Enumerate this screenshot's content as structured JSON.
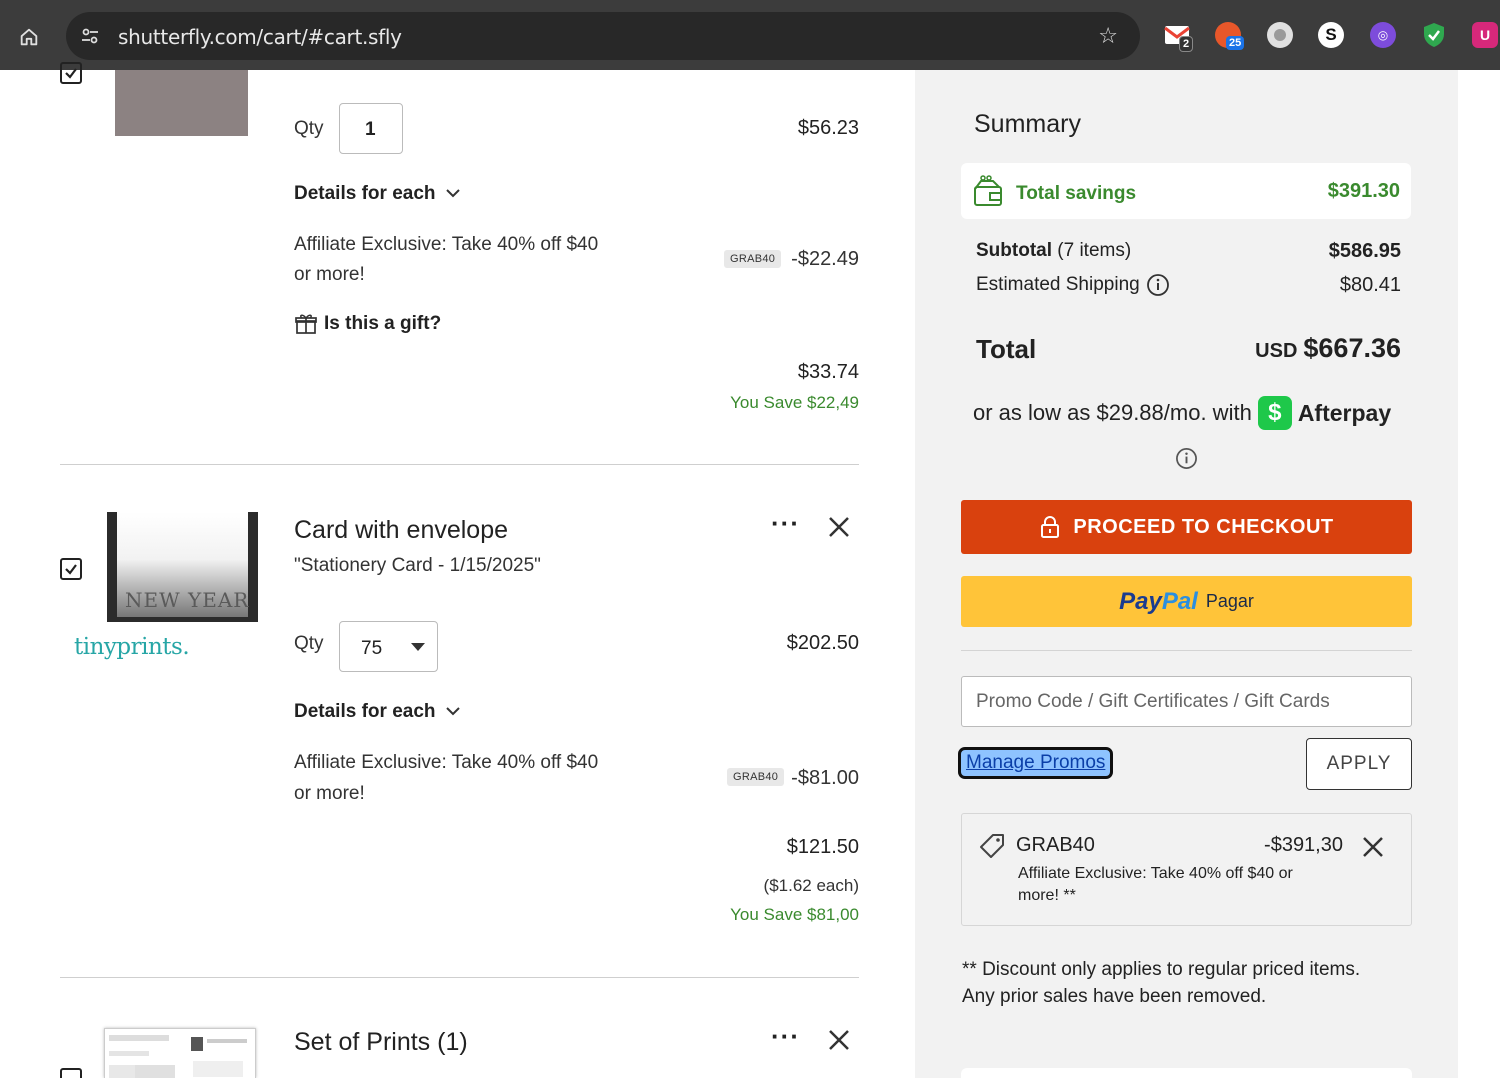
{
  "browser": {
    "url": "shutterfly.com/cart/#cart.sfly",
    "extensions": [
      {
        "name": "gmail-icon",
        "badge": "2"
      },
      {
        "name": "ext-25-icon",
        "badge": "25"
      },
      {
        "name": "circle-ext-icon"
      },
      {
        "name": "s-ext-icon",
        "label": "S"
      },
      {
        "name": "purple-ext-icon"
      },
      {
        "name": "shield-ext-icon"
      },
      {
        "name": "u-ext-icon",
        "label": "U"
      }
    ]
  },
  "item1": {
    "qty_label": "Qty",
    "qty": "1",
    "price": "$56.23",
    "details_label": "Details for each",
    "promo_text_line1": "Affiliate Exclusive: Take 40% off $40",
    "promo_text_line2": "or more!",
    "promo_code": "GRAB40",
    "promo_amount": "-$22.49",
    "gift_label": "Is this a gift?",
    "final_price": "$33.74",
    "you_save": "You Save $22,49"
  },
  "item2": {
    "title": "Card with envelope",
    "subtitle": "\"Stationery Card - 1/15/2025\"",
    "brand": "tinyprints.",
    "thumb_text": "NEW YEAR",
    "qty_label": "Qty",
    "qty": "75",
    "price": "$202.50",
    "details_label": "Details for each",
    "promo_text_line1": "Affiliate Exclusive: Take 40% off $40",
    "promo_text_line2": "or more!",
    "promo_code": "GRAB40",
    "promo_amount": "-$81.00",
    "final_price": "$121.50",
    "each_price": "($1.62 each)",
    "you_save": "You Save $81,00"
  },
  "item3": {
    "title": "Set of Prints (1)"
  },
  "summary": {
    "heading": "Summary",
    "savings_label": "Total savings",
    "savings_value": "$391.30",
    "subtotal_label": "Subtotal",
    "subtotal_items": "(7 items)",
    "subtotal_value": "$586.95",
    "shipping_label": "Estimated Shipping",
    "shipping_value": "$80.41",
    "total_label": "Total",
    "total_currency": "USD",
    "total_value": "$667.36",
    "afterpay_text": "or as low as $29.88/mo. with",
    "afterpay_brand": "Afterpay",
    "checkout_label": "PROCEED TO CHECKOUT",
    "paypal_brand_pay": "Pay",
    "paypal_brand_pal": "Pal",
    "paypal_label": "Pagar",
    "promo_placeholder": "Promo Code / Gift Certificates / Gift Cards",
    "manage_promos": "Manage Promos",
    "apply_label": "APPLY",
    "coupon_code": "GRAB40",
    "coupon_amount": "-$391,30",
    "coupon_desc_line1": "Affiliate Exclusive: Take 40% off $40 or",
    "coupon_desc_line2": "more! **",
    "disclaimer_line1": "** Discount only applies to regular priced items.",
    "disclaimer_line2": "Any prior sales have been removed."
  },
  "colors": {
    "checkout": "#d9410e",
    "paypal": "#ffc439",
    "savings_green": "#3a8a2e",
    "afterpay_green": "#1ec84a",
    "tinyprints_teal": "#27a6a6"
  }
}
